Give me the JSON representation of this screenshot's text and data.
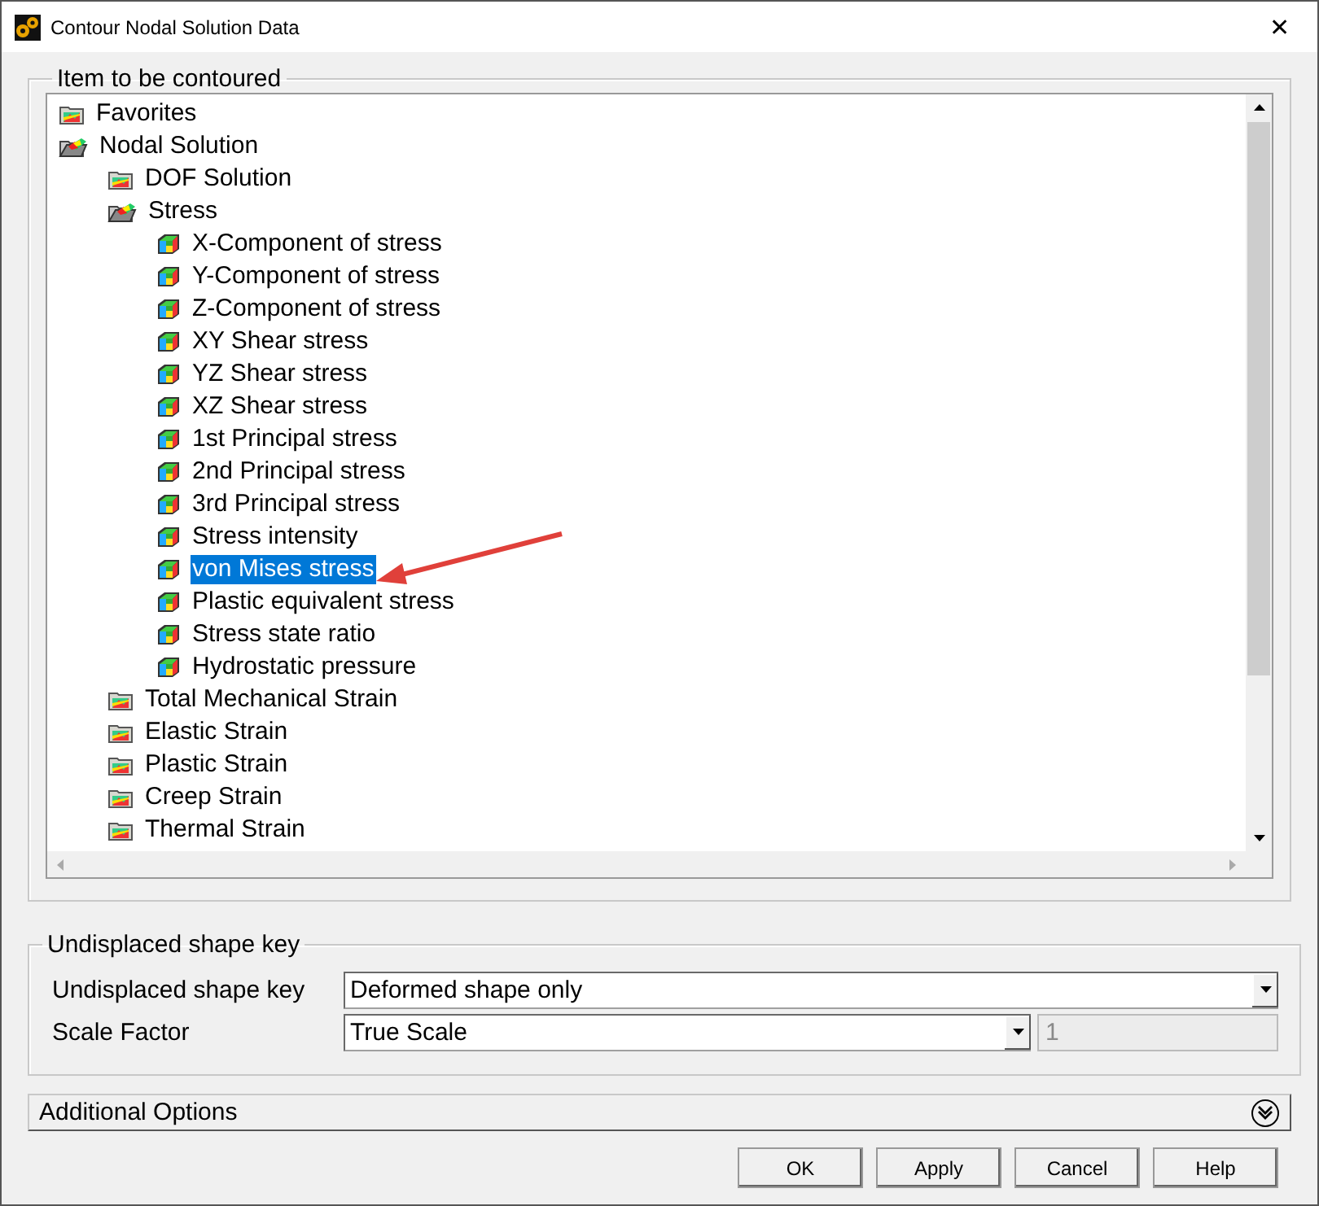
{
  "window": {
    "title": "Contour Nodal Solution Data",
    "close": "✕"
  },
  "item_group": {
    "title": "Item to be contoured",
    "tree": [
      {
        "label": "Favorites",
        "kind": "folder",
        "expanded": false,
        "selected": false
      },
      {
        "label": "Nodal Solution",
        "kind": "folder",
        "expanded": true,
        "selected": false,
        "children": [
          {
            "label": "DOF Solution",
            "kind": "folder",
            "expanded": false,
            "selected": false
          },
          {
            "label": "Stress",
            "kind": "folder",
            "expanded": true,
            "selected": false,
            "children": [
              {
                "label": "X-Component of stress",
                "kind": "item",
                "selected": false
              },
              {
                "label": "Y-Component of stress",
                "kind": "item",
                "selected": false
              },
              {
                "label": "Z-Component of stress",
                "kind": "item",
                "selected": false
              },
              {
                "label": "XY Shear stress",
                "kind": "item",
                "selected": false
              },
              {
                "label": "YZ Shear stress",
                "kind": "item",
                "selected": false
              },
              {
                "label": "XZ Shear stress",
                "kind": "item",
                "selected": false
              },
              {
                "label": "1st Principal stress",
                "kind": "item",
                "selected": false
              },
              {
                "label": "2nd Principal stress",
                "kind": "item",
                "selected": false
              },
              {
                "label": "3rd Principal stress",
                "kind": "item",
                "selected": false
              },
              {
                "label": "Stress intensity",
                "kind": "item",
                "selected": false
              },
              {
                "label": "von Mises stress",
                "kind": "item",
                "selected": true
              },
              {
                "label": "Plastic equivalent stress",
                "kind": "item",
                "selected": false
              },
              {
                "label": "Stress state ratio",
                "kind": "item",
                "selected": false
              },
              {
                "label": "Hydrostatic pressure",
                "kind": "item",
                "selected": false
              }
            ]
          },
          {
            "label": "Total Mechanical Strain",
            "kind": "folder",
            "expanded": false,
            "selected": false
          },
          {
            "label": "Elastic Strain",
            "kind": "folder",
            "expanded": false,
            "selected": false
          },
          {
            "label": "Plastic Strain",
            "kind": "folder",
            "expanded": false,
            "selected": false
          },
          {
            "label": "Creep Strain",
            "kind": "folder",
            "expanded": false,
            "selected": false
          },
          {
            "label": "Thermal Strain",
            "kind": "folder",
            "expanded": false,
            "selected": false
          }
        ]
      }
    ]
  },
  "shape_group": {
    "title": "Undisplaced shape key",
    "fields": [
      {
        "label": "Undisplaced shape key",
        "value": "Deformed shape only"
      },
      {
        "label": "Scale Factor",
        "value": "True Scale",
        "extra": {
          "value": "1",
          "disabled": true
        }
      }
    ]
  },
  "additional_options": {
    "label": "Additional Options",
    "expanded": false
  },
  "buttons": [
    "OK",
    "Apply",
    "Cancel",
    "Help"
  ]
}
